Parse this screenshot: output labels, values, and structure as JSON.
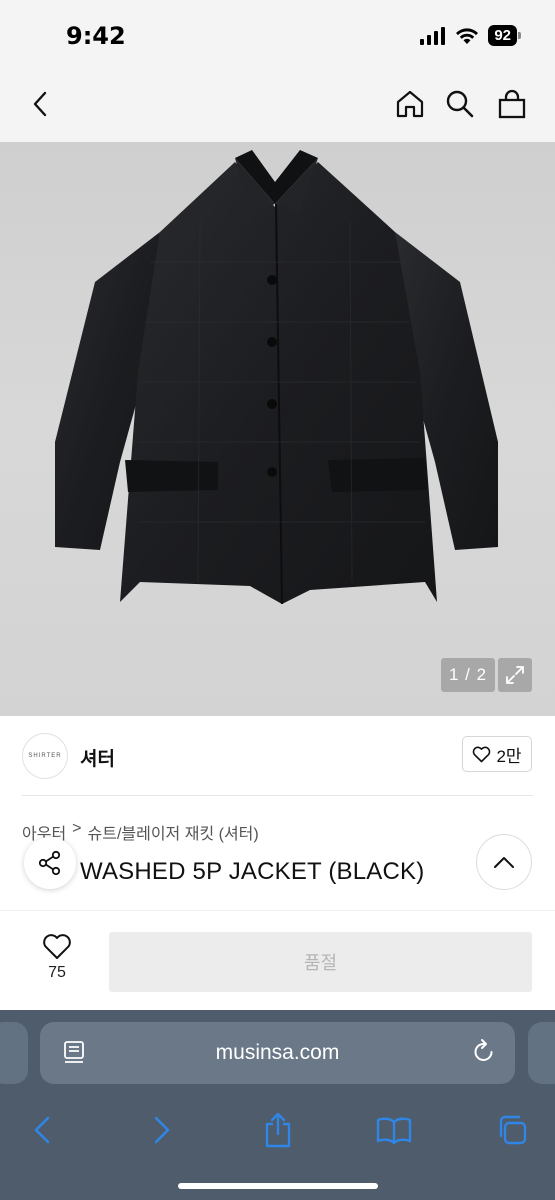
{
  "status_bar": {
    "time": "9:42",
    "battery": "92",
    "icons": [
      "signal-icon",
      "wifi-icon",
      "battery-icon"
    ]
  },
  "top_nav": {
    "icons": [
      "back-icon",
      "home-icon",
      "search-icon",
      "bag-icon"
    ]
  },
  "gallery": {
    "image_subject": "black washed 5P jacket",
    "pager": "1 / 2",
    "expand_icon": "expand-icon"
  },
  "brand": {
    "logo_text": "SHIRTER",
    "name": "셔터",
    "like_count": "2만"
  },
  "product": {
    "breadcrumb": [
      "아우터",
      ">",
      "슈트/블레이저 재킷 (셔터)"
    ],
    "title": "WASHED 5P JACKET (BLACK)"
  },
  "action_bar": {
    "wish_count": "75",
    "soldout_label": "품절"
  },
  "browser": {
    "url": "musinsa.com",
    "toolbar_icons": [
      "back-icon",
      "forward-icon",
      "share-icon",
      "bookmarks-icon",
      "tabs-icon"
    ]
  },
  "colors": {
    "safari_toolbar": "#4f5c6b",
    "safari_icon": "#2f86e6",
    "hero_bg": "#d3d3d3",
    "soldout_bg": "#ececec"
  }
}
